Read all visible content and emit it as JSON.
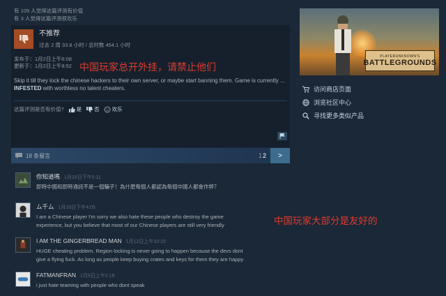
{
  "review": {
    "helpful_line_1": "有 109 人觉得这篇评测有价值",
    "helpful_line_2": "有 3 人觉得这篇评测很欢乐",
    "verdict": "不推荐",
    "hours": "过去 2 周 33.8 小时 / 总时数 454.1 小时",
    "posted": "发布于：1月2日上午6:08",
    "updated": "更新于：1月2日上午8:52",
    "annotation": "中国玩家总开外挂，请禁止他们",
    "body_prefix": "Skip it till they lock the chinese hackers to their own server, or maybe start banning them. Game is currently ... ",
    "body_bold": "INFESTED",
    "body_suffix": " with worthless no talent cheaters.",
    "vote_prompt": "这篇评测是否有价值?",
    "vote_yes": "是",
    "vote_no": "否",
    "vote_funny": "欢乐"
  },
  "comments_bar": {
    "count_label": "18 条留言",
    "page_1": "1",
    "page_2": "2",
    "next": ">"
  },
  "comments": [
    {
      "name": "你知道嗎",
      "date": "1月16日下午5:11",
      "text_1": "即時中國和即時通訊不是一個騙子！為什麼每個人都認為每個中國人都會作弊？",
      "text_2": ""
    },
    {
      "name": "ム千ム",
      "date": "1月16日下午4:05",
      "text_1": "I am a Chinese player I'm sorry we also hate these people who destroy the game",
      "text_2": "experience, but you believe that most of our Chinese players are still very friendly"
    },
    {
      "name": "I AM THE GINGERBREAD MAN",
      "date": "1月12日上午10:16",
      "text_1": "HUGE cheating problem. Region locking is never going to happen because the devs dont",
      "text_2": "give a flying fuck. As long as people keep buying crates and keys for them they are happy"
    },
    {
      "name": "FATMANFRAN",
      "date": "1月9日上午2:18",
      "text_1": "i just hate teaming with people who dont speak",
      "text_2": ""
    }
  ],
  "annotation_2": "中国玩家大部分是友好的",
  "sidebar": {
    "game_logo_line_1": "PLAYERUNKNOWN'S",
    "game_logo_line_2": "BATTLEGROUNDS",
    "links": [
      {
        "label": "访问商店页面",
        "icon": "cart-icon"
      },
      {
        "label": "浏览社区中心",
        "icon": "globe-icon"
      },
      {
        "label": "寻找更多类似产品",
        "icon": "search-icon"
      }
    ]
  },
  "colors": {
    "background": "#1b2838",
    "thumb_down": "#a34c25",
    "annotation": "#e03a2c",
    "pager_next": "#3d6c8d"
  }
}
